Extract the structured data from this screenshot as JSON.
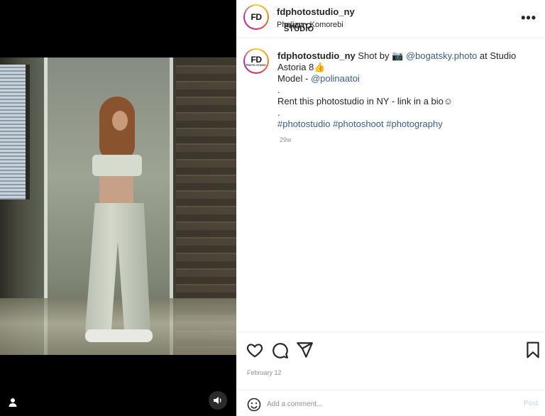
{
  "media": {
    "user_badge_icon": "user-icon",
    "sound_icon": "speaker-icon"
  },
  "header": {
    "avatar_text": "FD",
    "avatar_subtext": "PHOTO STUDIO",
    "username": "fdphotostudio_ny",
    "subtitle": "Phelian • Komorebi",
    "more_icon": "more-horizontal-icon",
    "more_label": "•••"
  },
  "caption": {
    "avatar_text": "FD",
    "avatar_subtext": "PHOTO STUDIO",
    "username": "fdphotostudio_ny",
    "shot_by": " Shot by 📷  ",
    "photographer": "@bogatsky.photo",
    "studio": " at Studio Astoria 8👍",
    "model_prefix": "Model - ",
    "model": "@polinaatoi",
    "dot1": ".",
    "rent": "Rent this photostudio in NY - link in a bio☺",
    "dot2": ".",
    "hashtags": "#photostudio #photoshoot #photography",
    "time": "29w"
  },
  "actions": {
    "like_icon": "heart-icon",
    "comment_icon": "comment-icon",
    "share_icon": "send-icon",
    "save_icon": "bookmark-icon",
    "date": "February 12"
  },
  "comment": {
    "emoji_icon": "emoji-icon",
    "placeholder": "Add a comment...",
    "post_label": "Post",
    "post_color": "#b9d8f7"
  }
}
